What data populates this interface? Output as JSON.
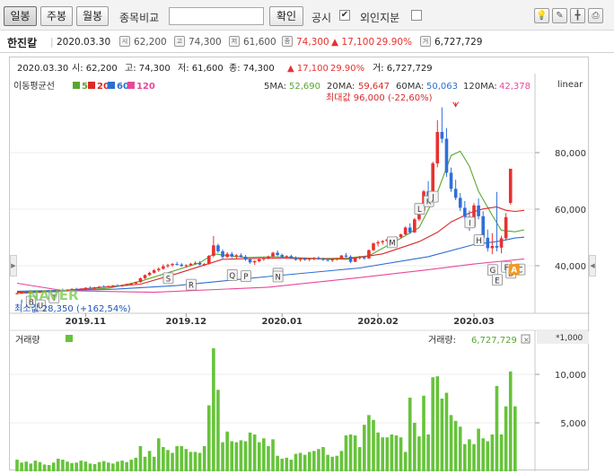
{
  "toolbar": {
    "period_buttons": [
      "일봉",
      "주봉",
      "월봉"
    ],
    "compare_label": "종목비교",
    "confirm_label": "확인",
    "disclosure_label": "공시",
    "foreign_label": "외인지분"
  },
  "stock": {
    "name": "한진칼",
    "date": "2020.03.30",
    "open": "62,200",
    "high": "74,300",
    "low": "61,600",
    "close": "74,300",
    "change": "▲ 17,100",
    "change_pct": "29.90%",
    "volume": "6,727,729"
  },
  "chart_header": {
    "date": "2020.03.30",
    "open_text": "시: 62,200",
    "high_text": "고: 74,300",
    "low_text": "저: 61,600",
    "close_text": "종: 74,300",
    "change_text": "▲  17,100",
    "pct_text": "29.90%",
    "vol_text": "거: 6,727,729"
  },
  "ma_legend": {
    "label": "이동평균선",
    "items": [
      {
        "name": "5",
        "color": "#5aa632"
      },
      {
        "name": "20",
        "color": "#d92a2a"
      },
      {
        "name": "60",
        "color": "#2c6fd1"
      },
      {
        "name": "120",
        "color": "#e8489a"
      }
    ]
  },
  "ma_values": {
    "ma5_label": "5MA:",
    "ma5": "52,690",
    "ma20_label": "20MA:",
    "ma20": "59,647",
    "ma60_label": "60MA:",
    "ma60": "50,063",
    "ma120_label": "120MA:",
    "ma120": "42,378",
    "scale": "linear"
  },
  "annotations": {
    "max_text": "최대값 96,000 (-22,60%)",
    "min_text": "최소값 28,350 (+162,54%)",
    "watermark": "NAVER"
  },
  "volume_panel": {
    "title": "거래량",
    "value_label": "거래량:",
    "value": "6,727,729",
    "unit": "*1,000"
  },
  "colors": {
    "up": "#e8312f",
    "down": "#2f6fd9",
    "volume": "#66c33a",
    "ma5": "#5aa632",
    "ma20": "#d92a2a",
    "ma60": "#2c6fd1",
    "ma120": "#e8489a"
  },
  "chart_data": {
    "type": "candlestick",
    "price_axis": {
      "ticks": [
        40000,
        60000,
        80000
      ],
      "tick_labels": [
        "40,000",
        "60,000",
        "80,000"
      ],
      "range": [
        25000,
        100000
      ]
    },
    "volume_axis": {
      "ticks": [
        5000,
        10000
      ],
      "tick_labels": [
        "5,000",
        "10,000"
      ],
      "range": [
        0,
        13000
      ],
      "unit": "*1,000"
    },
    "x_labels": [
      "2019.11",
      "2019.12",
      "2020.01",
      "2020.02",
      "2020.03"
    ],
    "x_label_index": [
      15,
      37,
      58,
      79,
      100
    ],
    "candles": [
      [
        30100,
        30500,
        29800,
        30300
      ],
      [
        30300,
        30800,
        30000,
        30500
      ],
      [
        30500,
        31000,
        30200,
        30400
      ],
      [
        30400,
        30900,
        30100,
        30800
      ],
      [
        30800,
        31200,
        30400,
        30600
      ],
      [
        30600,
        31000,
        30300,
        30900
      ],
      [
        30900,
        31300,
        30500,
        31000
      ],
      [
        31000,
        31500,
        30700,
        30800
      ],
      [
        30800,
        31200,
        30400,
        31100
      ],
      [
        31100,
        31600,
        30800,
        31400
      ],
      [
        31400,
        31900,
        31000,
        31200
      ],
      [
        31200,
        31700,
        30900,
        31500
      ],
      [
        31500,
        32000,
        31200,
        31800
      ],
      [
        31800,
        32200,
        31400,
        31600
      ],
      [
        31600,
        32100,
        31300,
        31900
      ],
      [
        31900,
        32400,
        31600,
        32200
      ],
      [
        32200,
        32700,
        31800,
        32000
      ],
      [
        32000,
        32500,
        31700,
        32400
      ],
      [
        32400,
        32800,
        32000,
        32600
      ],
      [
        32600,
        33100,
        32200,
        32400
      ],
      [
        32400,
        32900,
        32100,
        32800
      ],
      [
        32800,
        33200,
        32500,
        33000
      ],
      [
        33000,
        33500,
        32600,
        32800
      ],
      [
        32800,
        33300,
        32500,
        33200
      ],
      [
        33200,
        33600,
        32800,
        33400
      ],
      [
        33400,
        33900,
        33100,
        33700
      ],
      [
        33700,
        34400,
        33400,
        34200
      ],
      [
        34200,
        35800,
        34000,
        35600
      ],
      [
        35600,
        36900,
        35300,
        36700
      ],
      [
        36700,
        37900,
        36400,
        37500
      ],
      [
        37500,
        38800,
        37200,
        38400
      ],
      [
        38400,
        39400,
        37800,
        38900
      ],
      [
        38900,
        40500,
        38600,
        39800
      ],
      [
        39800,
        40700,
        39300,
        40200
      ],
      [
        40200,
        41000,
        39700,
        40600
      ],
      [
        40600,
        41400,
        40100,
        40400
      ],
      [
        40400,
        40900,
        39600,
        39900
      ],
      [
        39900,
        40500,
        39300,
        40200
      ],
      [
        40200,
        41000,
        39800,
        40700
      ],
      [
        40700,
        41500,
        40300,
        41000
      ],
      [
        41000,
        41700,
        40100,
        40400
      ],
      [
        40400,
        41000,
        39800,
        40600
      ],
      [
        40600,
        43800,
        40400,
        43500
      ],
      [
        43500,
        50500,
        43000,
        47200
      ],
      [
        47200,
        47800,
        44500,
        45100
      ],
      [
        45100,
        45800,
        42500,
        43100
      ],
      [
        43100,
        44800,
        42800,
        44200
      ],
      [
        44200,
        44900,
        42700,
        43300
      ],
      [
        43300,
        44100,
        42500,
        43700
      ],
      [
        43700,
        44400,
        42900,
        43200
      ],
      [
        43200,
        43800,
        41700,
        42200
      ],
      [
        42200,
        42800,
        40700,
        41200
      ],
      [
        41200,
        41900,
        40300,
        41600
      ],
      [
        41600,
        42700,
        41200,
        42300
      ],
      [
        42300,
        43100,
        41700,
        42600
      ],
      [
        42600,
        43600,
        42200,
        43200
      ],
      [
        43200,
        44900,
        43000,
        44600
      ],
      [
        44600,
        45400,
        43300,
        43800
      ],
      [
        43800,
        44300,
        42600,
        43100
      ],
      [
        43100,
        43700,
        42500,
        43400
      ],
      [
        43400,
        43900,
        42400,
        42700
      ],
      [
        42700,
        43300,
        41800,
        42100
      ],
      [
        42100,
        42700,
        41500,
        42400
      ],
      [
        42400,
        42900,
        41800,
        42200
      ],
      [
        42200,
        42800,
        41600,
        42500
      ],
      [
        42500,
        43100,
        41900,
        42800
      ],
      [
        42800,
        43300,
        42100,
        42400
      ],
      [
        42400,
        42900,
        41700,
        42100
      ],
      [
        42100,
        42600,
        41500,
        41900
      ],
      [
        41900,
        42500,
        41300,
        42300
      ],
      [
        42300,
        42800,
        41800,
        42600
      ],
      [
        42600,
        43800,
        42400,
        43600
      ],
      [
        43600,
        44500,
        42900,
        43200
      ],
      [
        43200,
        43700,
        40900,
        41400
      ],
      [
        41400,
        42900,
        41300,
        42700
      ],
      [
        42700,
        43500,
        42200,
        43000
      ],
      [
        43000,
        43400,
        42100,
        42600
      ],
      [
        42600,
        45800,
        42400,
        45500
      ],
      [
        45500,
        48200,
        45200,
        47900
      ],
      [
        47900,
        48900,
        46800,
        48300
      ],
      [
        48300,
        49100,
        47500,
        48700
      ],
      [
        48700,
        49600,
        48100,
        49300
      ],
      [
        49300,
        50000,
        48400,
        49700
      ],
      [
        49700,
        50400,
        49000,
        50100
      ],
      [
        50100,
        51300,
        49800,
        51100
      ],
      [
        51100,
        53900,
        50800,
        53500
      ],
      [
        53500,
        55000,
        51200,
        51800
      ],
      [
        51800,
        56900,
        51600,
        56400
      ],
      [
        56400,
        59900,
        55800,
        59500
      ],
      [
        59500,
        66800,
        59200,
        66300
      ],
      [
        66300,
        69900,
        63800,
        64600
      ],
      [
        64600,
        76800,
        64200,
        76200
      ],
      [
        76200,
        91500,
        74800,
        87300
      ],
      [
        87300,
        96000,
        83400,
        84900
      ],
      [
        84900,
        88700,
        71400,
        72900
      ],
      [
        72900,
        74700,
        66100,
        67200
      ],
      [
        67200,
        70400,
        63200,
        64000
      ],
      [
        64000,
        65700,
        59300,
        60500
      ],
      [
        60500,
        62900,
        56400,
        57300
      ],
      [
        57300,
        59500,
        52300,
        53700
      ],
      [
        53700,
        62100,
        53400,
        61300
      ],
      [
        61300,
        63800,
        56400,
        57500
      ],
      [
        57500,
        59300,
        48700,
        49900
      ],
      [
        49900,
        52800,
        45000,
        46200
      ],
      [
        46200,
        51500,
        44100,
        47000
      ],
      [
        47000,
        66100,
        45100,
        46400
      ],
      [
        46400,
        50600,
        44400,
        49700
      ],
      [
        49700,
        58600,
        49200,
        57200
      ],
      [
        62200,
        74300,
        61600,
        74300
      ]
    ],
    "volume": [
      1200,
      900,
      1000,
      800,
      1100,
      950,
      700,
      650,
      900,
      1300,
      1200,
      1000,
      850,
      900,
      1100,
      1000,
      800,
      750,
      950,
      1050,
      900,
      800,
      1000,
      1100,
      950,
      1200,
      1400,
      2600,
      1500,
      2100,
      1500,
      3400,
      2500,
      2200,
      1900,
      2600,
      2600,
      2300,
      2000,
      2000,
      1900,
      2600,
      6800,
      12700,
      8400,
      3000,
      4100,
      3100,
      3000,
      3200,
      3100,
      4000,
      3800,
      3000,
      3400,
      2600,
      3300,
      1600,
      1300,
      1400,
      1200,
      1800,
      1900,
      1700,
      2000,
      2100,
      2300,
      2500,
      1700,
      1500,
      1600,
      2100,
      3700,
      3800,
      3700,
      2500,
      4800,
      5800,
      5300,
      4000,
      3500,
      3500,
      3800,
      3700,
      3500,
      2000,
      7600,
      5000,
      3600,
      7800,
      3800,
      9700,
      9800,
      7500,
      8100,
      5800,
      5200,
      4600,
      2800,
      3300,
      2800,
      4400,
      3400,
      3100,
      3800,
      8800,
      3800,
      6700,
      10300,
      6700
    ],
    "ma_series": {
      "5": [
        [
          0,
          30200
        ],
        [
          20,
          32000
        ],
        [
          27,
          34500
        ],
        [
          40,
          41000
        ],
        [
          43,
          44200
        ],
        [
          50,
          42900
        ],
        [
          56,
          43200
        ],
        [
          66,
          42500
        ],
        [
          72,
          42700
        ],
        [
          77,
          43500
        ],
        [
          84,
          49700
        ],
        [
          88,
          53500
        ],
        [
          92,
          66000
        ],
        [
          95,
          79000
        ],
        [
          97,
          80500
        ],
        [
          99,
          75200
        ],
        [
          101,
          66300
        ],
        [
          104,
          57800
        ],
        [
          106,
          52500
        ],
        [
          109,
          52000
        ],
        [
          111,
          52700
        ]
      ],
      "20": [
        [
          0,
          30600
        ],
        [
          10,
          31200
        ],
        [
          27,
          33500
        ],
        [
          35,
          37200
        ],
        [
          45,
          42300
        ],
        [
          56,
          42700
        ],
        [
          72,
          42300
        ],
        [
          80,
          44200
        ],
        [
          88,
          48500
        ],
        [
          92,
          51800
        ],
        [
          95,
          55500
        ],
        [
          99,
          58600
        ],
        [
          102,
          60100
        ],
        [
          105,
          60800
        ],
        [
          107,
          59600
        ],
        [
          109,
          59200
        ],
        [
          111,
          59600
        ]
      ],
      "60": [
        [
          0,
          31000
        ],
        [
          20,
          31600
        ],
        [
          35,
          33000
        ],
        [
          55,
          36200
        ],
        [
          75,
          39200
        ],
        [
          90,
          43200
        ],
        [
          100,
          47500
        ],
        [
          106,
          48800
        ],
        [
          109,
          49800
        ],
        [
          111,
          50100
        ]
      ],
      "120": [
        [
          0,
          33800
        ],
        [
          10,
          31200
        ],
        [
          30,
          30600
        ],
        [
          55,
          32400
        ],
        [
          75,
          35800
        ],
        [
          90,
          38600
        ],
        [
          100,
          40600
        ],
        [
          106,
          41600
        ],
        [
          111,
          42400
        ]
      ]
    },
    "markers": [
      {
        "label": "S",
        "i": 33,
        "price": 35600
      },
      {
        "label": "R",
        "i": 38,
        "price": 33300
      },
      {
        "label": "Q",
        "i": 47,
        "price": 36700
      },
      {
        "label": "P",
        "i": 50,
        "price": 36300
      },
      {
        "label": "O",
        "i": 57,
        "price": 37200
      },
      {
        "label": "N",
        "i": 57,
        "price": 36200
      },
      {
        "label": "M",
        "i": 82,
        "price": 48300
      },
      {
        "label": "L",
        "i": 88,
        "price": 60100
      },
      {
        "label": "K",
        "i": 90,
        "price": 62800
      },
      {
        "label": "J",
        "i": 91,
        "price": 64400
      },
      {
        "label": "I",
        "i": 99,
        "price": 55300
      },
      {
        "label": "H",
        "i": 101,
        "price": 49000
      },
      {
        "label": "G",
        "i": 104,
        "price": 38500
      },
      {
        "label": "F",
        "i": 107,
        "price": 39600
      },
      {
        "label": "E",
        "i": 105,
        "price": 35000
      },
      {
        "label": "D",
        "i": 108,
        "price": 37500
      },
      {
        "label": "C",
        "i": 110,
        "price": 38700
      },
      {
        "label": "B",
        "i": 3,
        "price": 27300
      },
      {
        "label": "U",
        "i": 5,
        "price": 26000
      },
      {
        "label": "T",
        "i": 8,
        "price": 28800
      }
    ],
    "min_marker": {
      "i": 1,
      "price": 28350,
      "label": "최소값 28,350 (+162,54%)"
    },
    "max_marker": {
      "i": 96,
      "price": 96000,
      "label": "최대값 96,000 (-22,60%)"
    },
    "current_tag": "A"
  }
}
